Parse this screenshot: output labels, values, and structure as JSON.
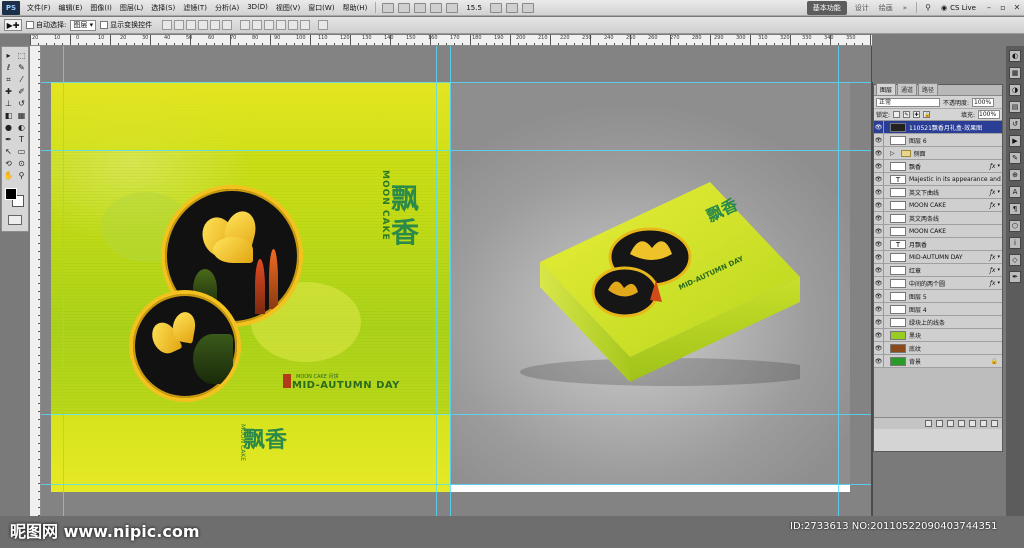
{
  "app": {
    "logo": "PS"
  },
  "menu": [
    "文件(F)",
    "编辑(E)",
    "图像(I)",
    "图层(L)",
    "选择(S)",
    "滤镜(T)",
    "分析(A)",
    "3D(D)",
    "视图(V)",
    "窗口(W)",
    "帮助(H)"
  ],
  "toolbar": {
    "zoom": "15.5"
  },
  "workspace": {
    "active": "基本功能",
    "items": [
      "设计",
      "绘画"
    ],
    "cslive": "CS Live"
  },
  "options": {
    "auto_select_label": "自动选择:",
    "auto_select_value": "图层",
    "show_transform": "显示变换控件"
  },
  "ruler": {
    "labels": [
      "20",
      "10",
      "0",
      "10",
      "20",
      "30",
      "40",
      "50",
      "60",
      "70",
      "80",
      "90",
      "100",
      "110",
      "120",
      "130",
      "140",
      "150",
      "160",
      "170",
      "180",
      "190",
      "200",
      "210",
      "220",
      "230",
      "240",
      "250",
      "260",
      "270",
      "280",
      "290",
      "300",
      "310",
      "320",
      "330",
      "340",
      "350"
    ]
  },
  "artwork": {
    "title_en": "MID-AUTUMN DAY",
    "sub_en": "MOON CAKE 月饼",
    "vertical_en": "MOON CAKE",
    "calligraphy": "飘香",
    "calligraphy_small": "飘香"
  },
  "layers_panel": {
    "tabs": [
      "图层",
      "通道",
      "路径"
    ],
    "blend_mode": "正常",
    "opacity_label": "不透明度:",
    "opacity": "100%",
    "lock_label": "锁定:",
    "fill_label": "填充:",
    "fill": "100%",
    "layers": [
      {
        "name": "110521飘香月礼盒-效果图",
        "selected": true,
        "thumb": "t-dark",
        "fx": false
      },
      {
        "name": "图层 6",
        "thumb": "",
        "fx": false
      },
      {
        "name": "侧面",
        "thumb": "t-folder",
        "fx": false,
        "group": true
      },
      {
        "name": "飘香",
        "thumb": "",
        "fx": true
      },
      {
        "name": "Majestic in its appearance and",
        "thumb": "t-text",
        "fx": false
      },
      {
        "name": "英文下曲线",
        "thumb": "",
        "fx": true
      },
      {
        "name": "MOON CAKE",
        "thumb": "",
        "fx": true
      },
      {
        "name": "英文两条线",
        "thumb": "",
        "fx": false
      },
      {
        "name": "MOON CAKE",
        "thumb": "",
        "fx": false
      },
      {
        "name": "月飘香",
        "thumb": "t-text",
        "fx": false
      },
      {
        "name": "MID-AUTUMN DAY",
        "thumb": "",
        "fx": true
      },
      {
        "name": "红章",
        "thumb": "",
        "fx": true
      },
      {
        "name": "中间的两个圆",
        "thumb": "",
        "fx": true
      },
      {
        "name": "图层 5",
        "thumb": "",
        "fx": false
      },
      {
        "name": "图层 4",
        "thumb": "",
        "fx": false
      },
      {
        "name": "绿块上的线条",
        "thumb": "",
        "fx": false
      },
      {
        "name": "黑块",
        "thumb": "t-green",
        "fx": false
      },
      {
        "name": "底纹",
        "thumb": "t-brown",
        "fx": false
      },
      {
        "name": "背景",
        "thumb": "t-solid",
        "fx": false,
        "locked": true
      }
    ]
  },
  "footer": {
    "watermark": "昵图网 www.nipic.com",
    "id": "ID:2733613 NO:20110522090403744351"
  }
}
